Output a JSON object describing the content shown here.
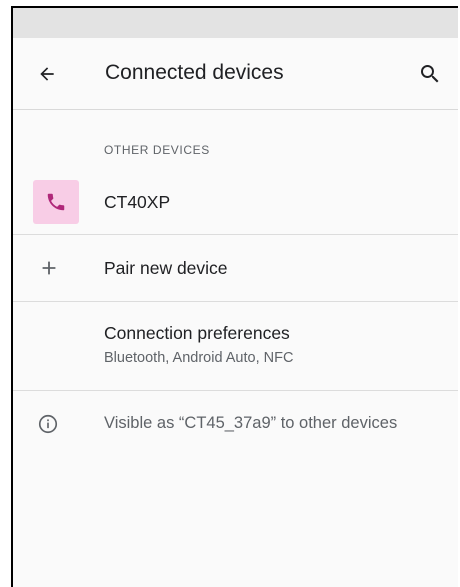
{
  "app_bar": {
    "title": "Connected devices",
    "back_icon": "arrow-back-icon",
    "search_icon": "search-icon"
  },
  "other_devices": {
    "header": "OTHER DEVICES",
    "devices": [
      {
        "name": "CT40XP",
        "icon": "phone-icon",
        "icon_bg": "#f8cde6",
        "icon_color": "#b0287a"
      }
    ]
  },
  "pair_new_device": {
    "label": "Pair new device",
    "icon": "plus-icon"
  },
  "connection_preferences": {
    "title": "Connection preferences",
    "subtitle": "Bluetooth, Android Auto, NFC"
  },
  "footer_info": {
    "icon": "info-icon",
    "text": "Visible as “CT45_37a9” to other devices"
  }
}
